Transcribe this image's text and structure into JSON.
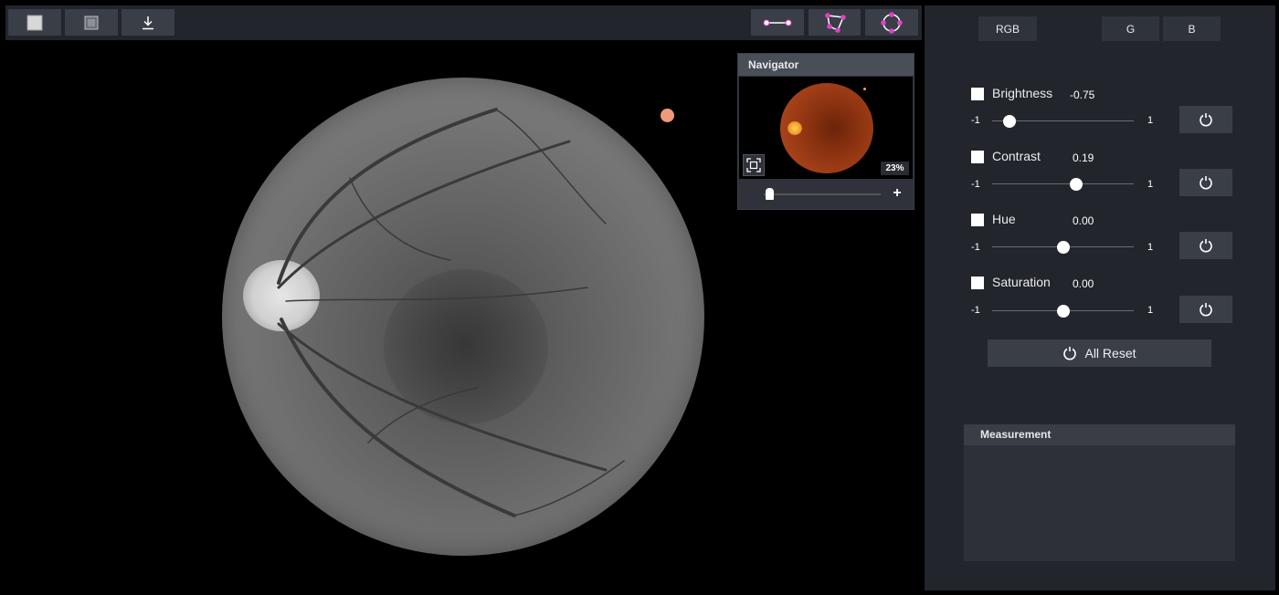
{
  "toolbar": {
    "left_buttons": [
      {
        "name": "square-filled-icon"
      },
      {
        "name": "square-frame-icon"
      },
      {
        "name": "download-icon"
      }
    ],
    "right_buttons": [
      {
        "name": "line-measure-icon"
      },
      {
        "name": "polygon-measure-icon"
      },
      {
        "name": "circle-measure-icon"
      }
    ],
    "accent": "#e040c8"
  },
  "viewer": {
    "marker_color": "#f19a7b"
  },
  "navigator": {
    "title": "Navigator",
    "zoom": "23%",
    "zoom_in_label": "+",
    "zoom_slider_fraction": 0.05
  },
  "channels": [
    {
      "label": "RGB"
    },
    {
      "label": "G"
    },
    {
      "label": "B"
    }
  ],
  "adjustments": [
    {
      "label": "Brightness",
      "value": "-0.75",
      "min": "-1",
      "max": "1",
      "numeric": -0.75
    },
    {
      "label": "Contrast",
      "value": "0.19",
      "min": "-1",
      "max": "1",
      "numeric": 0.19
    },
    {
      "label": "Hue",
      "value": "0.00",
      "min": "-1",
      "max": "1",
      "numeric": 0.0
    },
    {
      "label": "Saturation",
      "value": "0.00",
      "min": "-1",
      "max": "1",
      "numeric": 0.0
    }
  ],
  "all_reset_label": "All Reset",
  "measurement": {
    "title": "Measurement"
  }
}
